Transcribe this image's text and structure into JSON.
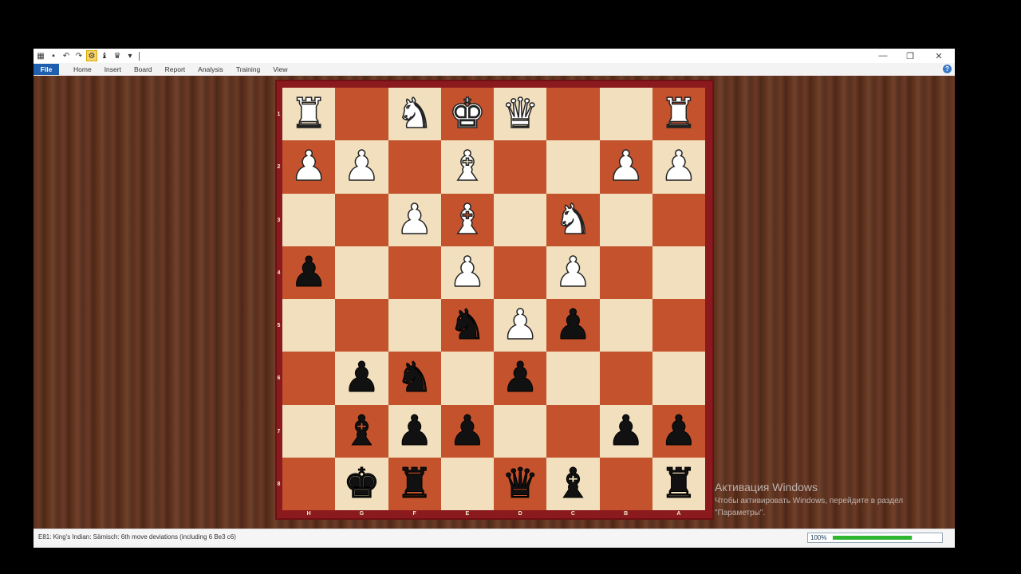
{
  "titlebar": {
    "quick_access": [
      "menu-icon",
      "save-icon",
      "undo-icon",
      "redo-icon",
      "engine-icon",
      "piece-icon",
      "crown-icon",
      "dropdown-icon"
    ],
    "minimize": "—",
    "maximize": "❐",
    "close": "✕"
  },
  "menu": {
    "file": "File",
    "items": [
      "Home",
      "Insert",
      "Board",
      "Report",
      "Analysis",
      "Training",
      "View"
    ],
    "help": "?"
  },
  "board": {
    "orientation": "black",
    "rank_labels": [
      "1",
      "2",
      "3",
      "4",
      "5",
      "6",
      "7",
      "8"
    ],
    "file_labels": [
      "H",
      "G",
      "F",
      "E",
      "D",
      "C",
      "B",
      "A"
    ],
    "rows": [
      [
        "wR",
        "",
        "wN",
        "wK",
        "wQ",
        "",
        "",
        "wR"
      ],
      [
        "wP",
        "wP",
        "",
        "wB",
        "",
        "",
        "wP",
        "wP"
      ],
      [
        "",
        "",
        "wP",
        "wB",
        "",
        "wN",
        "",
        ""
      ],
      [
        "bP",
        "",
        "",
        "wP",
        "",
        "wP",
        "",
        ""
      ],
      [
        "",
        "",
        "",
        "bN",
        "wP",
        "bP",
        "",
        ""
      ],
      [
        "",
        "bP",
        "bN",
        "",
        "bP",
        "",
        "",
        ""
      ],
      [
        "",
        "bB",
        "bP",
        "bP",
        "",
        "",
        "bP",
        "bP"
      ],
      [
        "",
        "bK",
        "bR",
        "",
        "bQ",
        "bB",
        "",
        "bR"
      ]
    ]
  },
  "watermark": {
    "title": "Активация Windows",
    "text": "Чтобы активировать Windows, перейдите в раздел \"Параметры\"."
  },
  "status": {
    "text": "E81: King's Indian: Sämisch: 6th move deviations (including 6 Be3 c6)",
    "zoom_label": "100%",
    "zoom_fraction": 0.985
  }
}
